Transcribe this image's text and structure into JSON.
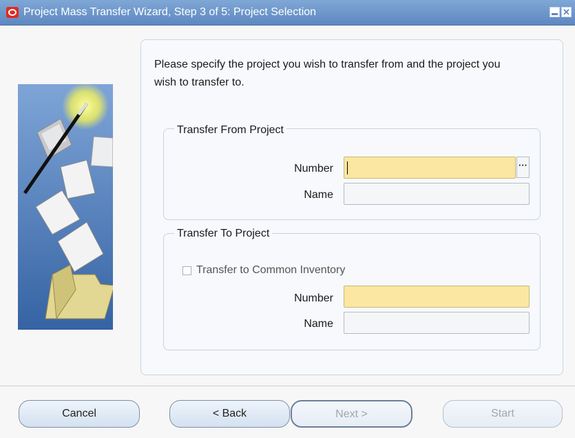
{
  "window": {
    "title": "Project Mass Transfer Wizard, Step 3 of 5: Project Selection"
  },
  "instruction": "Please specify the project you wish to transfer from and the project you wish to transfer to.",
  "transfer_from": {
    "legend": "Transfer From Project",
    "number_label": "Number",
    "number_value": "",
    "name_label": "Name",
    "name_value": ""
  },
  "transfer_to": {
    "legend": "Transfer To Project",
    "common_inventory_label": "Transfer to Common Inventory",
    "common_inventory_checked": false,
    "number_label": "Number",
    "number_value": "",
    "name_label": "Name",
    "name_value": ""
  },
  "buttons": {
    "cancel": "Cancel",
    "back": "< Back",
    "next": "Next >",
    "start": "Start"
  }
}
